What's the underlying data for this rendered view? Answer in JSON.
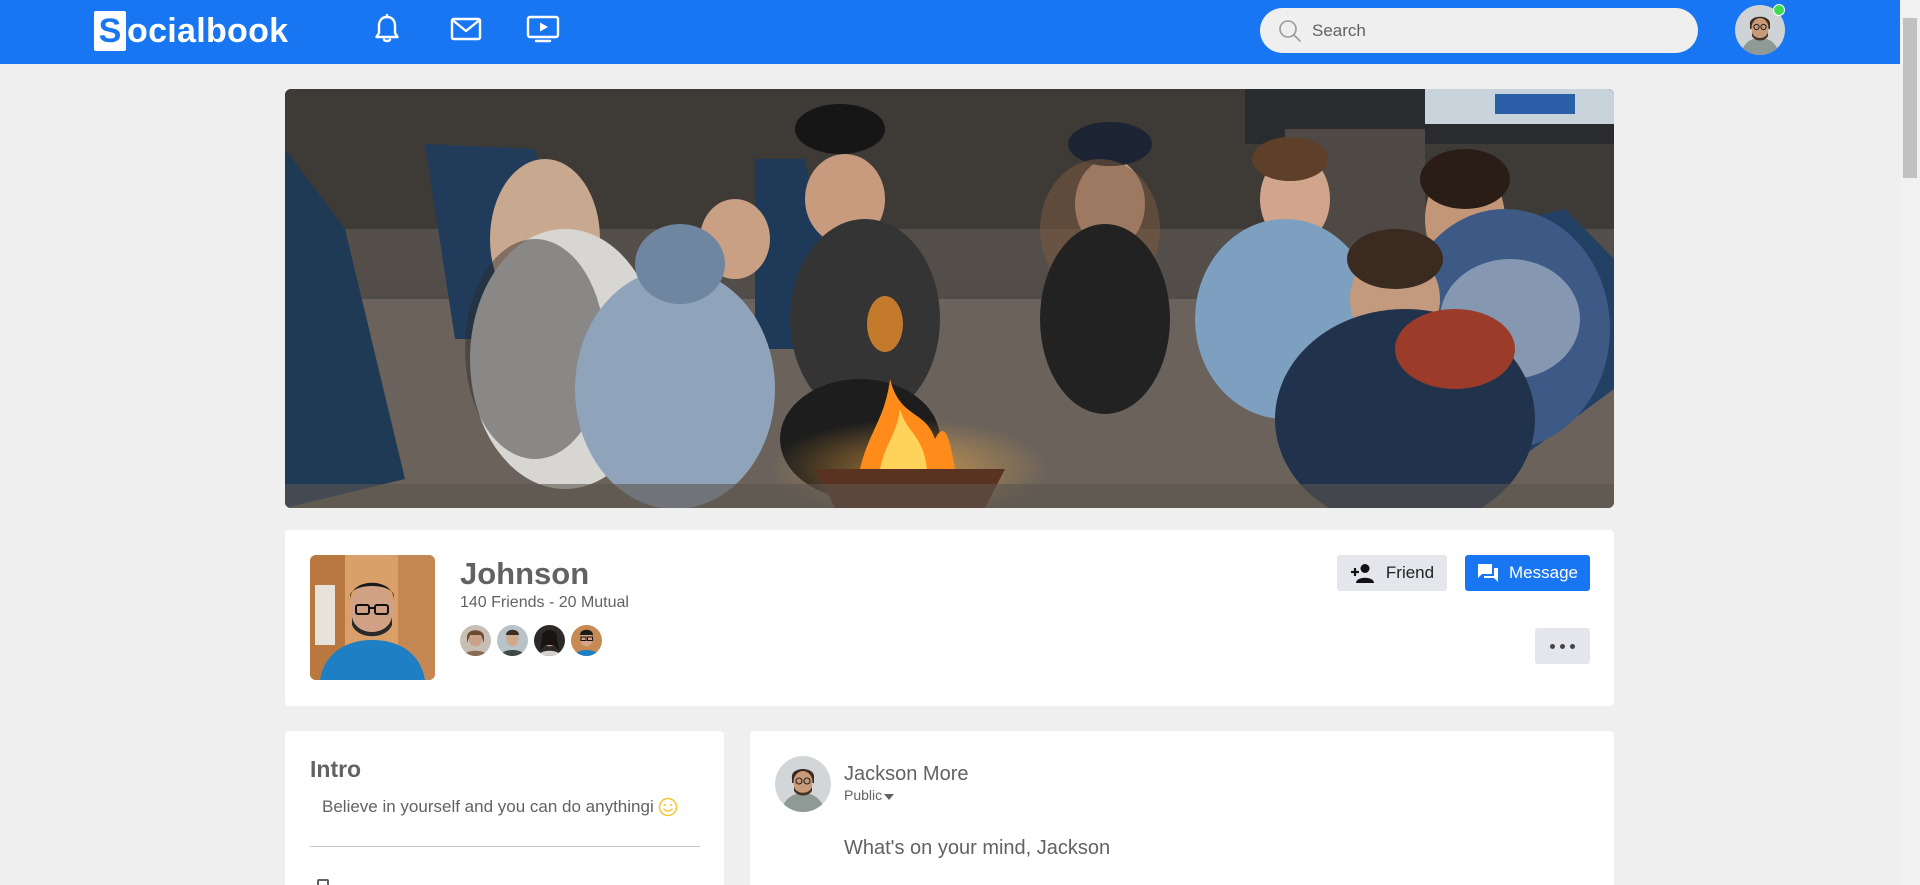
{
  "app": {
    "logo_letter": "S",
    "logo_rest": "ocialbook"
  },
  "navbar": {
    "icons": [
      "bell-icon",
      "mail-icon",
      "video-icon"
    ],
    "search_placeholder": "Search",
    "online_status_color": "#41db51"
  },
  "colors": {
    "brand": "#1876f2",
    "background": "#efefef",
    "text": "#626262"
  },
  "profile": {
    "name": "Johnson",
    "friends_text": "140 Friends - 20 Mutual",
    "friend_button": "Friend",
    "message_button": "Message"
  },
  "intro": {
    "title": "Intro",
    "text": "Believe in yourself and you can do anythingi"
  },
  "post": {
    "user": "Jackson More",
    "privacy": "Public",
    "placeholder": "What's on your mind, Jackson"
  }
}
